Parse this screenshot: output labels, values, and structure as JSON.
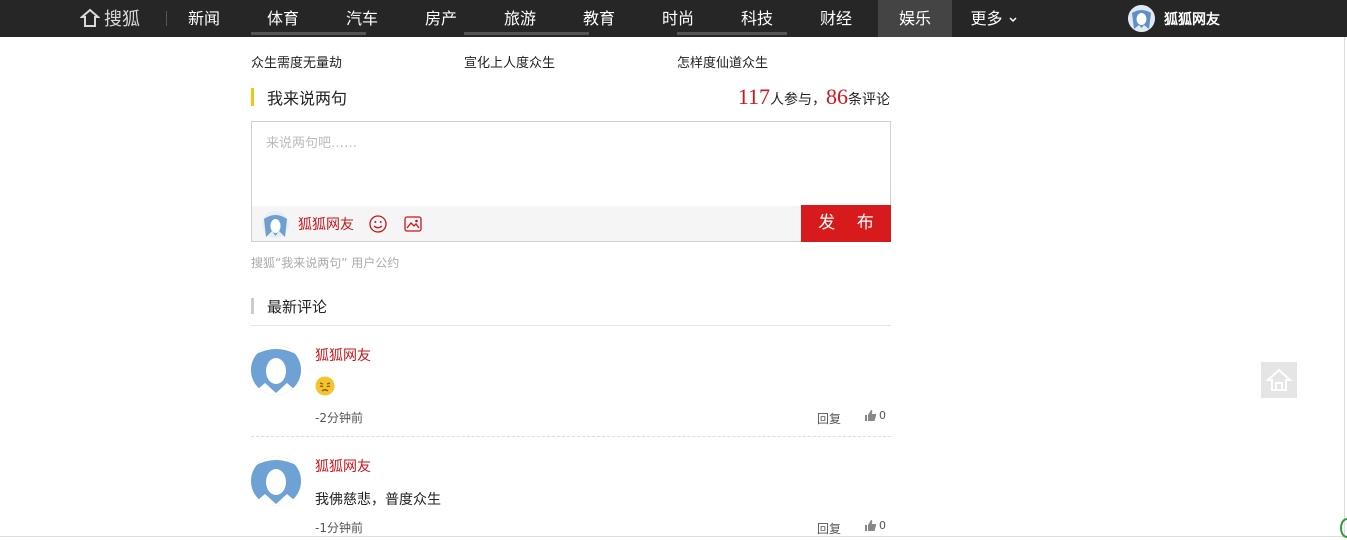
{
  "nav": {
    "logo": "搜狐",
    "items": [
      {
        "label": "新闻"
      },
      {
        "label": "体育"
      },
      {
        "label": "汽车"
      },
      {
        "label": "房产"
      },
      {
        "label": "旅游"
      },
      {
        "label": "教育"
      },
      {
        "label": "时尚"
      },
      {
        "label": "科技"
      },
      {
        "label": "财经"
      },
      {
        "label": "娱乐"
      },
      {
        "label": "更多"
      }
    ],
    "active": "娱乐",
    "user_name": "狐狐网友"
  },
  "related": {
    "items": [
      "众生需度无量劫",
      "宣化上人度众生",
      "怎样度仙道众生"
    ]
  },
  "comments_section": {
    "title": "我来说两句",
    "participants": "117",
    "participants_suffix": "人参与，",
    "comment_count": "86",
    "comment_suffix": "条评论",
    "placeholder": "来说两句吧……",
    "user_name": "狐狐网友",
    "publish_label": "发 布",
    "policy": "搜狐“我来说两句” 用户公约"
  },
  "latest": {
    "title": "最新评论",
    "comments": [
      {
        "user": "狐狐网友",
        "text": "",
        "emoji": "emoji-icon",
        "time": "-2分钟前",
        "reply": "回复",
        "likes": "0"
      },
      {
        "user": "狐狐网友",
        "text": "我佛慈悲，普度众生",
        "time": "-1分钟前",
        "reply": "回复",
        "likes": "0"
      }
    ]
  },
  "colors": {
    "accent_red": "#d71a1b",
    "nav_bg": "#262626",
    "highlight_yellow": "#f5c216"
  }
}
